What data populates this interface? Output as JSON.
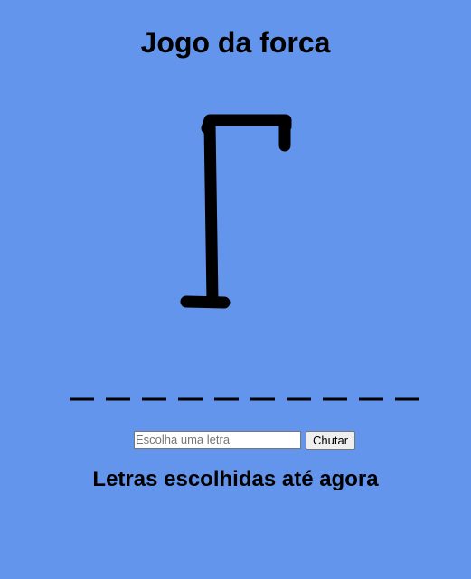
{
  "game": {
    "title": "Jogo da forca",
    "word_length": 10,
    "input_placeholder": "Escolha uma letra",
    "guess_button_label": "Chutar",
    "chosen_letters_heading": "Letras escolhidas até agora",
    "chosen_letters": []
  },
  "colors": {
    "background": "#6495ed",
    "ink": "#000000"
  }
}
